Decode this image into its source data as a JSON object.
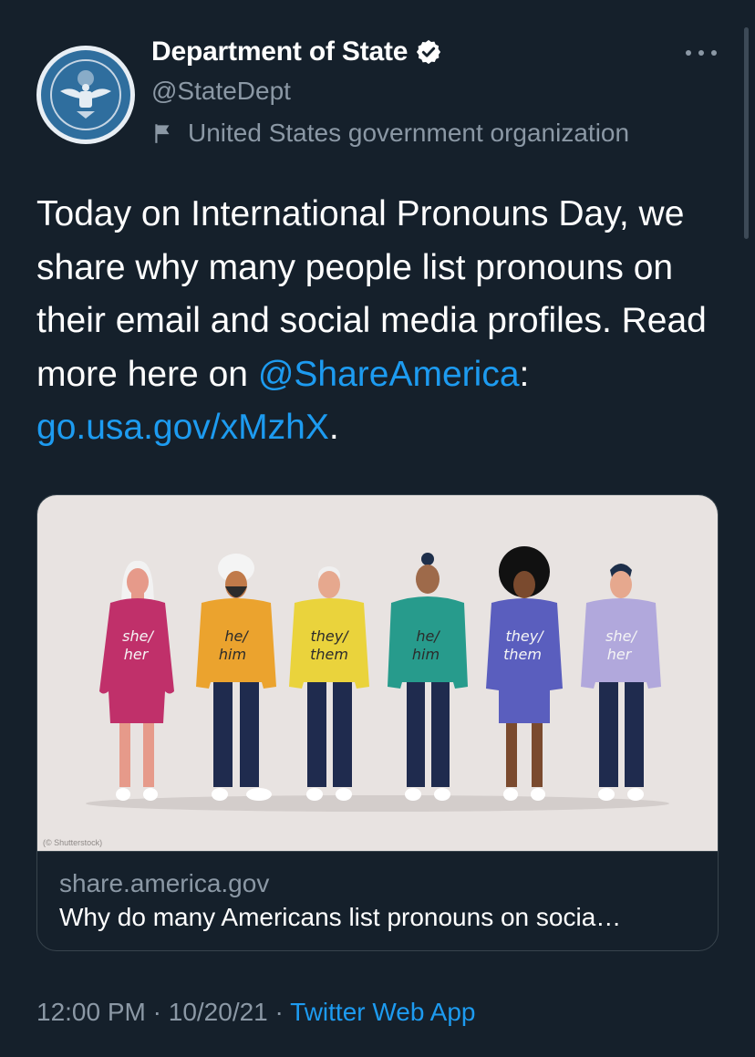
{
  "author": {
    "name": "Department of State",
    "handle": "@StateDept",
    "label": "United States government organization",
    "verified": true,
    "avatar_icon": "department-of-state-seal"
  },
  "tweet": {
    "text_part1": "Today on International Pronouns Day, we share why many people list pronouns on their email and social media profiles. Read more here on ",
    "mention": "@ShareAmerica",
    "separator": ": ",
    "link": "go.usa.gov/xMzhX",
    "end": "."
  },
  "card": {
    "image_credit": "(© Shutterstock)",
    "domain": "share.america.gov",
    "title": "Why do many Americans list pronouns on socia…",
    "figures": [
      {
        "line1": "she/",
        "line2": "her"
      },
      {
        "line1": "he/",
        "line2": "him"
      },
      {
        "line1": "they/",
        "line2": "them"
      },
      {
        "line1": "he/",
        "line2": "him"
      },
      {
        "line1": "they/",
        "line2": "them"
      },
      {
        "line1": "she/",
        "line2": "her"
      }
    ]
  },
  "meta": {
    "time": "12:00 PM",
    "dot1": " · ",
    "date": "10/20/21",
    "dot2": " · ",
    "app": "Twitter Web App"
  },
  "colors": {
    "background": "#15202b",
    "link": "#1d9bf0",
    "secondary_text": "#8b98a5"
  }
}
